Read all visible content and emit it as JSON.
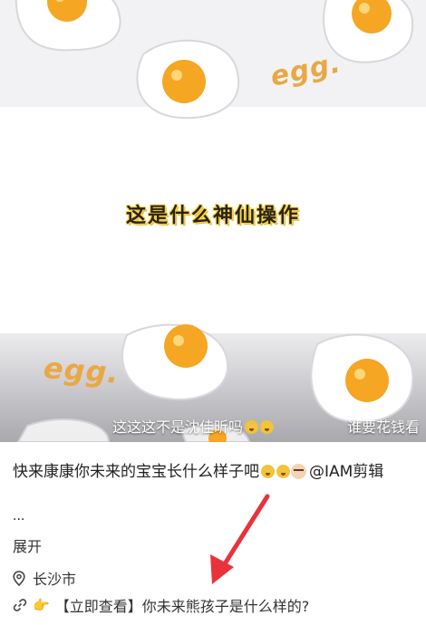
{
  "video": {
    "caption": "这是什么神仙操作",
    "sticker_texts": [
      "egg.",
      "egg."
    ],
    "danmaku": [
      {
        "text": "这这这不是沈佳昕吗"
      },
      {
        "text": "谁要花钱看"
      }
    ]
  },
  "post": {
    "title": "快来康康你未来的宝宝长什么样子吧",
    "mention": "@IAM剪辑",
    "ellipsis": "...",
    "expand_label": "展开",
    "location": "长沙市",
    "link_text": "【立即查看】你未来熊孩子是什么样的?"
  },
  "icons": {
    "location": "location-pin-icon",
    "link": "link-icon",
    "hand": "pointing-hand-icon",
    "annotation": "red-arrow"
  },
  "colors": {
    "caption_outline": "#f6d64c",
    "egg_yolk": "#f5a623",
    "arrow": "#e8333b"
  }
}
